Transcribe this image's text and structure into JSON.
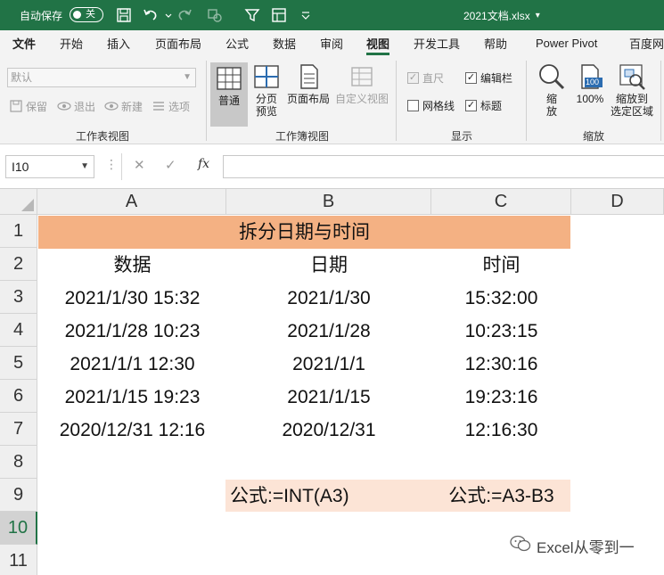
{
  "titlebar": {
    "autosave_label": "自动保存",
    "autosave_state": "关",
    "doc_title": "2021文档.xlsx",
    "title_arrow": "▾"
  },
  "tabs": [
    "文件",
    "开始",
    "插入",
    "页面布局",
    "公式",
    "数据",
    "审阅",
    "视图",
    "开发工具",
    "帮助",
    "Power Pivot",
    "百度网"
  ],
  "active_tab": "视图",
  "ribbon": {
    "sheet_view": {
      "dropdown_value": "默认",
      "keep": "保留",
      "exit": "退出",
      "new": "新建",
      "options": "选项",
      "label": "工作表视图"
    },
    "workbook_view": {
      "normal": "普通",
      "page_break_l1": "分页",
      "page_break_l2": "预览",
      "page_layout": "页面布局",
      "custom": "自定义视图",
      "label": "工作簿视图"
    },
    "show": {
      "ruler": "直尺",
      "formula_bar": "编辑栏",
      "gridlines": "网格线",
      "headings": "标题",
      "label": "显示"
    },
    "zoom": {
      "zoom_l1": "缩",
      "zoom_l2": "放",
      "hundred": "100%",
      "hundred_icon": "100",
      "to_sel_l1": "缩放到",
      "to_sel_l2": "选定区域",
      "label": "缩放"
    }
  },
  "formula_bar": {
    "name_box": "I10",
    "dots": "⋮",
    "cancel": "✕",
    "enter": "✓",
    "fx": "fx",
    "content": ""
  },
  "grid": {
    "columns": [
      "A",
      "B",
      "C",
      "D"
    ],
    "rows": [
      "1",
      "2",
      "3",
      "4",
      "5",
      "6",
      "7",
      "8",
      "9",
      "10",
      "11"
    ],
    "active_row": "10",
    "title": "拆分日期与时间",
    "headers": [
      "数据",
      "日期",
      "时间"
    ],
    "data": [
      [
        "2021/1/30 15:32",
        "2021/1/30",
        "15:32:00"
      ],
      [
        "2021/1/28 10:23",
        "2021/1/28",
        "10:23:15"
      ],
      [
        "2021/1/1 12:30",
        "2021/1/1",
        "12:30:16"
      ],
      [
        "2021/1/15 19:23",
        "2021/1/15",
        "19:23:16"
      ],
      [
        "2020/12/31 12:16",
        "2020/12/31",
        "12:16:30"
      ]
    ],
    "formula_b": "公式:=INT(A3)",
    "formula_c": "公式:=A3-B3"
  },
  "watermark": "Excel从零到一",
  "colors": {
    "brand": "#217346",
    "title_fill": "#f4b183",
    "formula_fill": "#fce4d6"
  }
}
